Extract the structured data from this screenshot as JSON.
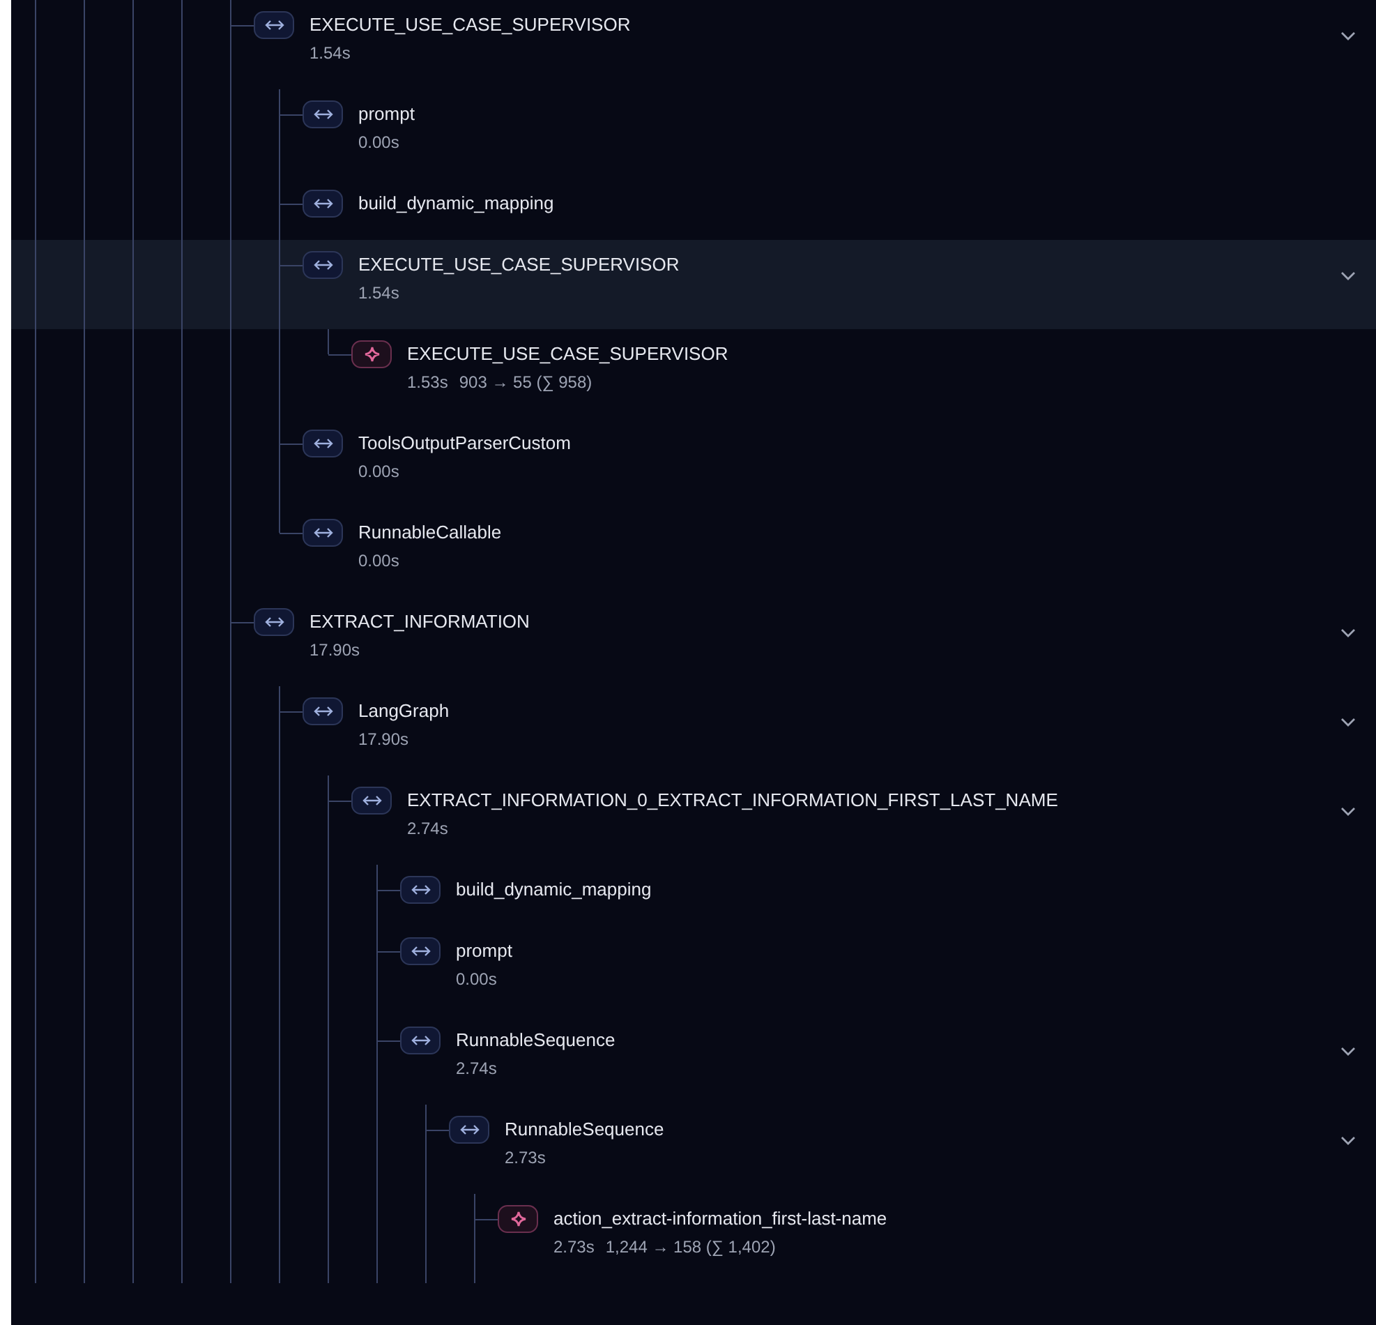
{
  "trace": [
    {
      "name": "EXECUTE_USE_CASE_SUPERVISOR",
      "kind": "chain",
      "duration": "1.54s",
      "expanded": true,
      "selected": false,
      "children": [
        {
          "name": "prompt",
          "kind": "chain",
          "duration": "0.00s",
          "selected": false
        },
        {
          "name": "build_dynamic_mapping",
          "kind": "chain",
          "selected": false
        },
        {
          "name": "EXECUTE_USE_CASE_SUPERVISOR",
          "kind": "chain",
          "duration": "1.54s",
          "expanded": true,
          "selected": true,
          "children": [
            {
              "name": "EXECUTE_USE_CASE_SUPERVISOR",
              "kind": "llm",
              "duration": "1.53s",
              "tokens": "903 → 55 (∑ 958)",
              "selected": false
            }
          ]
        },
        {
          "name": "ToolsOutputParserCustom",
          "kind": "chain",
          "duration": "0.00s",
          "selected": false
        },
        {
          "name": "RunnableCallable",
          "kind": "chain",
          "duration": "0.00s",
          "selected": false
        }
      ]
    },
    {
      "name": "EXTRACT_INFORMATION",
      "kind": "chain",
      "duration": "17.90s",
      "expanded": true,
      "selected": false,
      "children": [
        {
          "name": "LangGraph",
          "kind": "chain",
          "duration": "17.90s",
          "expanded": true,
          "selected": false,
          "children": [
            {
              "name": "EXTRACT_INFORMATION_0_EXTRACT_INFORMATION_FIRST_LAST_NAME",
              "kind": "chain",
              "duration": "2.74s",
              "expanded": true,
              "selected": false,
              "children": [
                {
                  "name": "build_dynamic_mapping",
                  "kind": "chain",
                  "selected": false
                },
                {
                  "name": "prompt",
                  "kind": "chain",
                  "duration": "0.00s",
                  "selected": false
                },
                {
                  "name": "RunnableSequence",
                  "kind": "chain",
                  "duration": "2.74s",
                  "expanded": true,
                  "selected": false,
                  "children": [
                    {
                      "name": "RunnableSequence",
                      "kind": "chain",
                      "duration": "2.73s",
                      "expanded": true,
                      "selected": false,
                      "children": [
                        {
                          "name": "action_extract-information_first-last-name",
                          "kind": "llm",
                          "duration": "2.73s",
                          "tokens": "1,244 → 158 (∑ 1,402)",
                          "selected": false
                        }
                      ]
                    }
                  ]
                }
              ]
            }
          ]
        }
      ]
    }
  ]
}
